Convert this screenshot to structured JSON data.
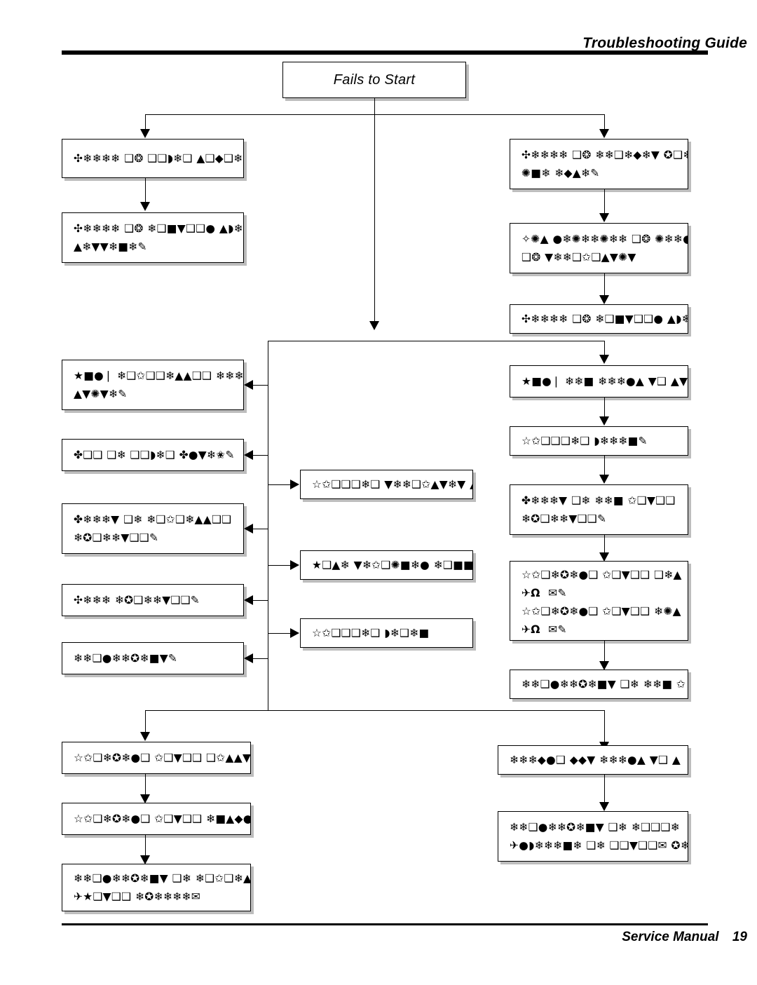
{
  "header": {
    "title": "Troubleshooting Guide"
  },
  "footer": {
    "label": "Service Manual",
    "page": "19"
  },
  "flowchart": {
    "start": {
      "label": "Fails to Start"
    },
    "nodes": [
      {
        "id": "l1",
        "text": "✣❄❄❄❄ ❑❂ ❑❑◗❄❑ ▲❑◆❑❄❄✎"
      },
      {
        "id": "l2",
        "text": "✣❄❄❄❄ ❑❂ ❄❑■▼❑❑● ▲◗❄▼❄❄\n▲❄▼▼❄■❄✎"
      },
      {
        "id": "r1",
        "text": "✣❄❄❄❄ ❑❂ ❄❄❑❄◆❄▼ ✪❑❄✬\n✺■❄ ❄◆▲❄✎"
      },
      {
        "id": "r2",
        "text": "✧✺▲ ●❄✺❄❄✺❄❄ ❑❂ ✺❄❄●❄\n❑❂ ▼❄❄❑✩❑▲▼✺▼"
      },
      {
        "id": "r3",
        "text": "✣❄❄❄❄ ❑❂ ❄❑■▼❑❑● ▲◗❄✬"
      },
      {
        "id": "m1",
        "text": "★■●❘ ❄❑✩❑❑❄▲▲❑❑ ❄❄❄●▲ ▼❑\n▲▼✺▼❄✎"
      },
      {
        "id": "m2",
        "text": "✤❑❑ ❑❄ ❑❑◗❄❑ ✤●▼❄✬✎"
      },
      {
        "id": "m3",
        "text": "✤❄❄❄▼ ❑❄ ❄❑✩❑❄▲▲❑❑\n❄✪❑❄❄▼❑❑✎"
      },
      {
        "id": "m4",
        "text": "✣❄❄❄ ❄✪❑❄❄▼❑❑✎"
      },
      {
        "id": "m5",
        "text": "❄❄❑●❄❄✪❄■▼✎"
      },
      {
        "id": "c1",
        "text": "☆✩❑❑❑❄❑ ▼❄❄❑✩▲▼❄▼ ▲❄▼▼❄■"
      },
      {
        "id": "c2",
        "text": "★❑▲❄ ▼❄✩❑✺■❄● ❄❑■■❄❄▼❄❑✎"
      },
      {
        "id": "c3",
        "text": "☆✩❑❑❑❄❑ ◗❄❑❄■"
      },
      {
        "id": "rr1",
        "text": "★■●❘ ❄❄■ ❄❄❄●▲ ▼❑ ▲▼✺"
      },
      {
        "id": "rr2",
        "text": "☆✩❑❑❑❄❑ ◗❄❄❄■✎"
      },
      {
        "id": "rr3",
        "text": "✤❄❄❄▼ ❑❄ ❄❄■ ✩❑▼❑❑\n❄✪❑❄❄▼❑❑✎"
      },
      {
        "id": "rr4",
        "text": "☆✩❑❄✪❄●❑ ✩❑▼❑❑ ❑❄▲\n✈Ω  ✉✎\n☆✩❑❄✪❄●❑ ✩❑▼❑❑ ❄✺▲\n✈Ω  ✉✎"
      },
      {
        "id": "rr5",
        "text": "❄❄❑●❄❄✪❄■▼ ❑❄ ❄❄■ ✩"
      },
      {
        "id": "bl1",
        "text": "☆✩❑❄✪❄●❑ ✩❑▼❑❑ ❑✩▲▲▼✺■❄❄ ✈  ✉"
      },
      {
        "id": "bl2",
        "text": "☆✩❑❄✪❄●❑ ✩❑▼❑❑ ❄■▲◆●✺▼❄❑■ ✈  ✉"
      },
      {
        "id": "bl3",
        "text": "❄❄❑●❄❄✪❄■▼ ❑❄ ❄❑✩❑❄▲▲❑❑\n✈★❑▼❑❑ ❄✪❄❄❄❄✉"
      },
      {
        "id": "br1",
        "text": "❄❄❄◆●❑ ◆◆▼ ❄❄❄●▲ ▼❑ ▲"
      },
      {
        "id": "br2",
        "text": "❄❄❑●❄❄✪❄■▼ ❑❄ ❄❑❑❑❄\n✈●◗❄❄❄■❄ ❑❄ ❑❑▼❑❑✉ ✪❄✬"
      }
    ],
    "connector_names": [
      "start-to-spine",
      "spine-split-top",
      "arrow-to-l1",
      "l1-to-l2",
      "arrow-to-r1",
      "r1-to-r2",
      "r2-to-r3",
      "center-spine-down",
      "left-rail",
      "arrow-into-m1",
      "arrow-into-m3",
      "arrow-into-m4",
      "arrow-into-m5",
      "arrow-into-m2",
      "arrow-to-c1",
      "arrow-to-c2",
      "arrow-to-c3",
      "right-branch-down",
      "rr1-to-rr2",
      "rr2-to-rr3",
      "rr3-to-rr4",
      "rr4-to-rr5",
      "bottom-spine",
      "bottom-split",
      "arrow-to-bl1",
      "bl1-to-bl2",
      "bl2-to-bl3",
      "arrow-to-br1",
      "br1-to-br2"
    ]
  }
}
